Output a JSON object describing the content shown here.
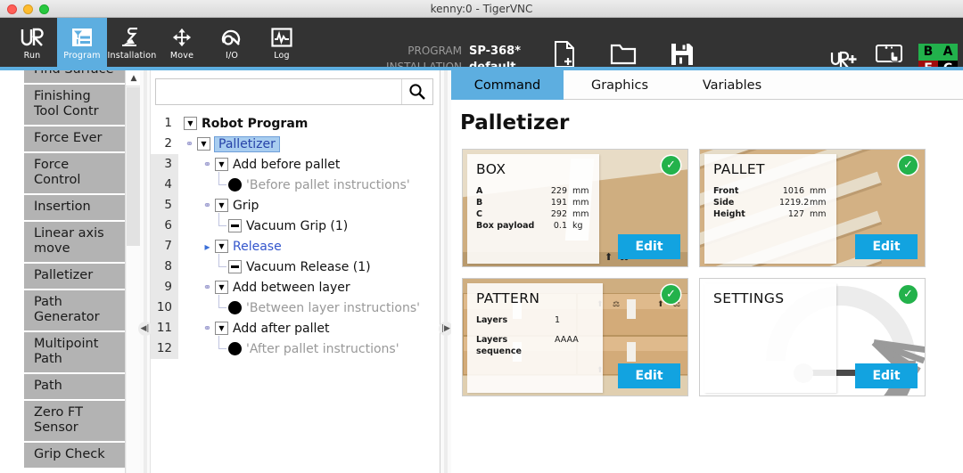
{
  "window": {
    "title": "kenny:0 - TigerVNC"
  },
  "header": {
    "nav": [
      {
        "label": "Run",
        "icon": "ur-logo-icon",
        "active": false
      },
      {
        "label": "Program",
        "icon": "program-icon",
        "active": true
      },
      {
        "label": "Installation",
        "icon": "robot-arm-icon",
        "active": false
      },
      {
        "label": "Move",
        "icon": "move-arrows-icon",
        "active": false
      },
      {
        "label": "I/O",
        "icon": "io-icon",
        "active": false
      },
      {
        "label": "Log",
        "icon": "log-waveform-icon",
        "active": false
      }
    ],
    "meta": [
      {
        "key": "PROGRAM",
        "value": "SP-368*"
      },
      {
        "key": "INSTALLATION",
        "value": "default"
      }
    ],
    "file_buttons": [
      {
        "label": "New...",
        "icon": "new-file-icon"
      },
      {
        "label": "Open...",
        "icon": "open-folder-icon"
      },
      {
        "label": "Save...",
        "icon": "save-floppy-icon"
      }
    ],
    "right_buttons": [
      {
        "label": "",
        "icon": "urplus-icon"
      },
      {
        "label": "Local",
        "icon": "local-control-icon"
      }
    ],
    "status_grid": {
      "b": "B",
      "a": "A",
      "e": "E",
      "c": "C"
    },
    "colors": {
      "bar": "#333333",
      "accent": "#5daee0",
      "ok": "#22b14c",
      "stop": "#a00c0c"
    }
  },
  "palette": {
    "items": [
      {
        "label": "Find Surface",
        "clipped": true
      },
      {
        "label": "Finishing Tool Contr"
      },
      {
        "label": "Force Ever"
      },
      {
        "label": "Force Control"
      },
      {
        "label": "Insertion"
      },
      {
        "label": "Linear axis move"
      },
      {
        "label": "Palletizer"
      },
      {
        "label": "Path Generator"
      },
      {
        "label": "Multipoint Path"
      },
      {
        "label": "Path"
      },
      {
        "label": "Zero FT Sensor"
      },
      {
        "label": "Grip Check"
      }
    ],
    "scroll_up_icon": "chevron-up-icon"
  },
  "tree_panel": {
    "search": {
      "value": "",
      "placeholder": "",
      "icon": "search-icon"
    },
    "rows": [
      {
        "num": "1",
        "label": "Robot Program",
        "style": "bold",
        "indent": 0,
        "toggle": "collapse-triangle",
        "pin": false,
        "shaded": false
      },
      {
        "num": "2",
        "label": "Palletizer",
        "style": "selected",
        "indent": 1,
        "toggle": "collapse-triangle",
        "pin": true,
        "shaded": false
      },
      {
        "num": "3",
        "label": "Add before pallet",
        "style": "normal",
        "indent": 2,
        "toggle": "collapse-triangle",
        "pin": true,
        "shaded": true
      },
      {
        "num": "4",
        "label": "'Before pallet instructions'",
        "style": "quote",
        "indent": 3,
        "toggle": "comment-bubble",
        "pin": false,
        "shaded": true
      },
      {
        "num": "5",
        "label": "Grip",
        "style": "normal",
        "indent": 2,
        "toggle": "collapse-triangle",
        "pin": true,
        "shaded": true
      },
      {
        "num": "6",
        "label": "Vacuum Grip  (1)",
        "style": "normal",
        "indent": 3,
        "toggle": "dash-node",
        "pin": false,
        "shaded": true
      },
      {
        "num": "7",
        "label": "Release",
        "style": "link",
        "indent": 2,
        "toggle": "collapse-triangle",
        "pin": "arrow",
        "shaded": true
      },
      {
        "num": "8",
        "label": "Vacuum Release  (1)",
        "style": "normal",
        "indent": 3,
        "toggle": "dash-node",
        "pin": false,
        "shaded": true
      },
      {
        "num": "9",
        "label": "Add between layer",
        "style": "normal",
        "indent": 2,
        "toggle": "collapse-triangle",
        "pin": true,
        "shaded": true
      },
      {
        "num": "10",
        "label": "'Between layer instructions'",
        "style": "quote",
        "indent": 3,
        "toggle": "comment-bubble",
        "pin": false,
        "shaded": true
      },
      {
        "num": "11",
        "label": "Add after pallet",
        "style": "normal",
        "indent": 2,
        "toggle": "collapse-triangle",
        "pin": true,
        "shaded": true
      },
      {
        "num": "12",
        "label": "'After pallet instructions'",
        "style": "quote",
        "indent": 3,
        "toggle": "comment-bubble",
        "pin": false,
        "shaded": true
      }
    ]
  },
  "main": {
    "tabs": [
      {
        "label": "Command",
        "active": true
      },
      {
        "label": "Graphics",
        "active": false
      },
      {
        "label": "Variables",
        "active": false
      }
    ],
    "title": "Palletizer",
    "cards": [
      {
        "id": "box",
        "title": "BOX",
        "status": "ok",
        "edit_label": "Edit",
        "specs": [
          {
            "key": "A",
            "value": "229",
            "unit": "mm"
          },
          {
            "key": "B",
            "value": "191",
            "unit": "mm"
          },
          {
            "key": "C",
            "value": "292",
            "unit": "mm"
          },
          {
            "key": "Box payload",
            "value": "0.1",
            "unit": "kg"
          }
        ]
      },
      {
        "id": "pallet",
        "title": "PALLET",
        "status": "ok",
        "edit_label": "Edit",
        "specs": [
          {
            "key": "Front",
            "value": "1016",
            "unit": "mm"
          },
          {
            "key": "Side",
            "value": "1219.2",
            "unit": "mm"
          },
          {
            "key": "Height",
            "value": "127",
            "unit": "mm"
          }
        ]
      },
      {
        "id": "pattern",
        "title": "PATTERN",
        "status": "ok",
        "edit_label": "Edit",
        "specs": [
          {
            "key": "Layers",
            "value": "1",
            "unit": ""
          },
          {
            "key": "Layers sequence",
            "value": "AAAA",
            "unit": ""
          }
        ]
      },
      {
        "id": "settings",
        "title": "SETTINGS",
        "status": "ok",
        "edit_label": "Edit",
        "specs": []
      }
    ]
  },
  "splitters": {
    "left_icon": "collapse-left-icon",
    "right_icon": "collapse-right-icon"
  }
}
